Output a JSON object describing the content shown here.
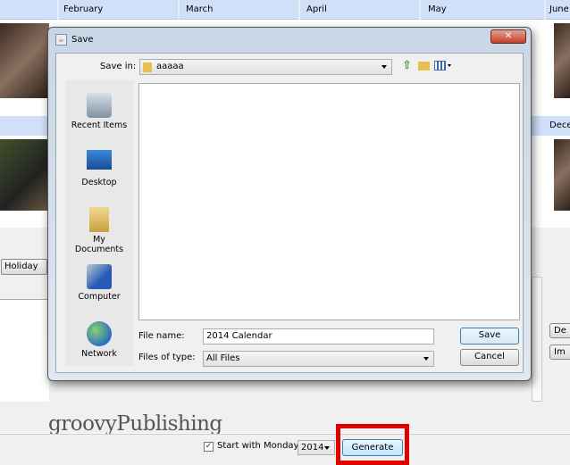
{
  "background": {
    "months_row1": [
      "February",
      "March",
      "April",
      "May",
      "June"
    ],
    "months_row2": [
      "Dece"
    ],
    "holiday_label": "Holiday",
    "right_buttons": [
      "De",
      "Im"
    ],
    "watermark": "groovyPublishing",
    "start_monday_label": "Start with Monday",
    "start_monday_checked": true,
    "year_value": "2014",
    "generate_label": "Generate",
    "highlight_color": "#e00000"
  },
  "dialog": {
    "title": "Save",
    "save_in_label": "Save in:",
    "save_in_value": "aaaaa",
    "places": [
      "Recent Items",
      "Desktop",
      "My Documents",
      "Computer",
      "Network"
    ],
    "file_name_label": "File name:",
    "file_name_value": "2014 Calendar",
    "files_of_type_label": "Files of type:",
    "files_of_type_value": "All Files",
    "save_button": "Save",
    "cancel_button": "Cancel"
  }
}
